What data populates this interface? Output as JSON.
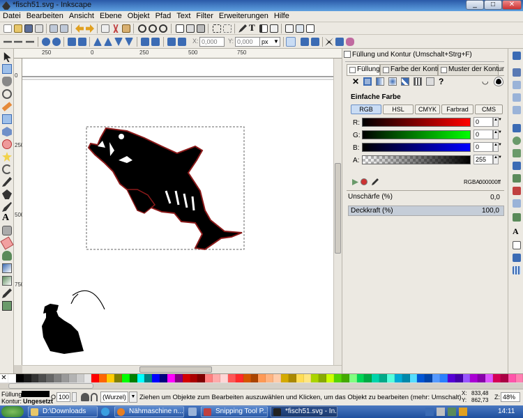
{
  "window": {
    "title": "*fisch51.svg - Inkscape",
    "buttons": {
      "minimize": "_",
      "maximize": "□",
      "close": "✕"
    }
  },
  "menu": [
    "Datei",
    "Bearbeiten",
    "Ansicht",
    "Ebene",
    "Objekt",
    "Pfad",
    "Text",
    "Filter",
    "Erweiterungen",
    "Hilfe"
  ],
  "controls": {
    "x_label": "X:",
    "x_value": "0,000",
    "y_label": "Y:",
    "y_value": "0,000",
    "unit": "px"
  },
  "rulers": {
    "h": [
      "250",
      "0",
      "250",
      "500",
      "750"
    ],
    "v": [
      "0",
      "250",
      "500",
      "750"
    ]
  },
  "panel": {
    "title": "Füllung und Kontur (Umschalt+Strg+F)",
    "tabs": [
      "Füllung",
      "Farbe der Kontur",
      "Muster der Kontur"
    ],
    "fill_type_unknown": "?",
    "fill_label": "Einfache Farbe",
    "modes": [
      "RGB",
      "HSL",
      "CMYK",
      "Farbrad",
      "CMS"
    ],
    "channels": [
      {
        "label": "R:",
        "value": "0"
      },
      {
        "label": "G:",
        "value": "0"
      },
      {
        "label": "B:",
        "value": "0"
      },
      {
        "label": "A:",
        "value": "255"
      }
    ],
    "rgba_label": "RGBA:",
    "rgba_value": "000000ff",
    "blur_label": "Unschärfe (%)",
    "blur_value": "0,0",
    "opacity_label": "Deckkraft (%)",
    "opacity_value": "100,0",
    "opacity_level": 1.0
  },
  "status": {
    "fill_label": "Füllung:",
    "stroke_label": "Kontur:",
    "stroke_value": "Ungesetzt",
    "opacity_label": "O:",
    "opacity_value": "100",
    "layer": "(Wurzel)",
    "message": "Ziehen um Objekte zum Bearbeiten auszuwählen und Klicken, um das Objekt zu bearbeiten (mehr: Umschalt)",
    "x_label": "X:",
    "x_value": "833,48",
    "y_label": "Y:",
    "y_value": "862,73",
    "zoom_label": "Z:",
    "zoom_value": "48%"
  },
  "palette": [
    "#ffffff",
    "#000000",
    "#1a1a1a",
    "#333333",
    "#4d4d4d",
    "#666666",
    "#808080",
    "#999999",
    "#b3b3b3",
    "#cccccc",
    "#e6e6e6",
    "#ff0000",
    "#ff6600",
    "#ffcc00",
    "#808000",
    "#00ff00",
    "#008000",
    "#00ffff",
    "#008080",
    "#0000ff",
    "#000080",
    "#ff00ff",
    "#800080",
    "#d40000",
    "#aa0000",
    "#800000",
    "#ff8080",
    "#ffaaaa",
    "#ffd5d5",
    "#ff5555",
    "#ff2a2a",
    "#d45500",
    "#aa4400",
    "#ff9955",
    "#ffb380",
    "#ffccaa",
    "#d4aa00",
    "#aa8800",
    "#ffdd55",
    "#ffe680",
    "#aad400",
    "#88aa00",
    "#ccff00",
    "#55d400",
    "#44aa00",
    "#80ff80",
    "#00d455",
    "#00aa44",
    "#00d4aa",
    "#00aa88",
    "#55ffdd",
    "#00aad4",
    "#0088aa",
    "#55ddff",
    "#0055d4",
    "#0044aa",
    "#5599ff",
    "#2a7fff",
    "#5500d4",
    "#4400aa",
    "#9955ff",
    "#aa00d4",
    "#8800aa",
    "#dd55ff",
    "#d40055",
    "#aa0044",
    "#ff55aa",
    "#ff80b2"
  ],
  "taskbar": {
    "items": [
      "D:\\Downloads",
      "Nähmaschine n...",
      "Snipping Tool P...",
      "*fisch51.svg - In..."
    ],
    "clock": "14:11"
  }
}
